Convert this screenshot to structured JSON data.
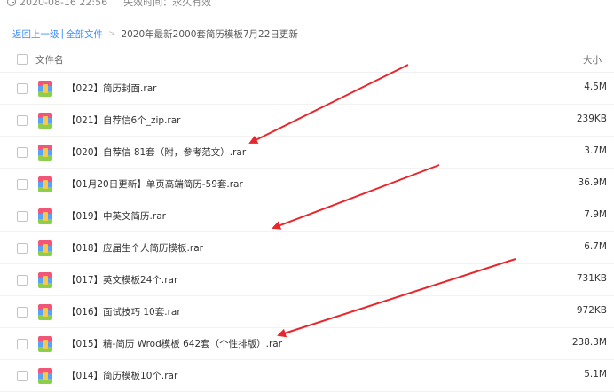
{
  "meta": {
    "date": "2020-08-16 22:56",
    "expire": "失效时间：永久有效"
  },
  "breadcrumb": {
    "back": "返回上一级",
    "separator": "|",
    "all_files": "全部文件",
    "chevron": ">",
    "current": "2020年最新2000套简历模板7月22日更新"
  },
  "header": {
    "name": "文件名",
    "size": "大小"
  },
  "files": [
    {
      "name": "【022】简历封面.rar",
      "size": "4.5M"
    },
    {
      "name": "【021】自荐信6个_zip.rar",
      "size": "239KB"
    },
    {
      "name": "【020】自荐信 81套（附，参考范文）.rar",
      "size": "3.7M"
    },
    {
      "name": "【01月20日更新】单页高端简历-59套.rar",
      "size": "36.9M"
    },
    {
      "name": "【019】中英文简历.rar",
      "size": "7.9M"
    },
    {
      "name": "【018】应届生个人简历模板.rar",
      "size": "6.7M"
    },
    {
      "name": "【017】英文模板24个.rar",
      "size": "731KB"
    },
    {
      "name": "【016】面试技巧 10套.rar",
      "size": "972KB"
    },
    {
      "name": "【015】精-简历 Wrod模板 642套（个性排版）.rar",
      "size": "238.3M"
    },
    {
      "name": "【014】简历模板10个.rar",
      "size": "5.1M"
    }
  ],
  "annotation_color": "#e8262b"
}
